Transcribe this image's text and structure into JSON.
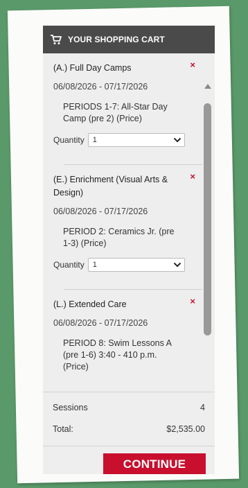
{
  "header": {
    "title": "YOUR SHOPPING CART",
    "icon": "cart-icon"
  },
  "items": [
    {
      "title": "(A.) Full Day Camps",
      "dates": "06/08/2026 - 07/17/2026",
      "period": "PERIODS 1-7: All-Star Day Camp (pre 2) (Price)",
      "quantity_label": "Quantity",
      "quantity_value": "1",
      "remove": "×"
    },
    {
      "title": "(E.) Enrichment (Visual Arts & Design)",
      "dates": "06/08/2026 - 07/17/2026",
      "period": "PERIOD 2: Ceramics Jr. (pre 1-3) (Price)",
      "quantity_label": "Quantity",
      "quantity_value": "1",
      "remove": "×"
    },
    {
      "title": "(L.) Extended Care",
      "dates": "06/08/2026 - 07/17/2026",
      "period": "PERIOD 8: Swim Lessons A (pre 1-6) 3:40 - 410 p.m. (Price)",
      "remove": "×"
    }
  ],
  "summary": {
    "sessions_label": "Sessions",
    "sessions_value": "4",
    "total_label": "Total:",
    "total_value": "$2,535.00"
  },
  "footer": {
    "continue_label": "CONTINUE"
  },
  "colors": {
    "accent": "#c8102e",
    "header_bg": "#4a4a4a",
    "panel_bg": "#eeeeee",
    "background": "#5a9a6a"
  }
}
